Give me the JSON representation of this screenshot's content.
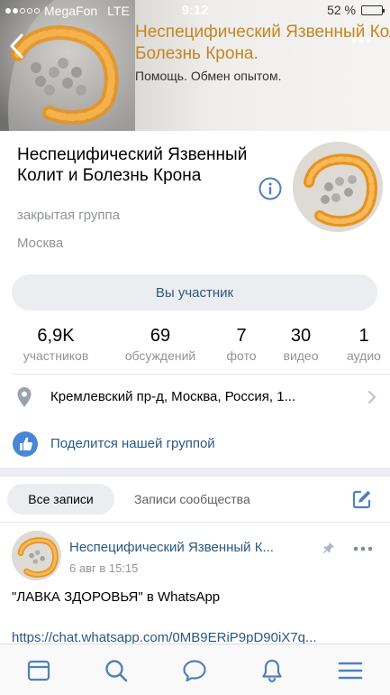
{
  "status_bar": {
    "carrier": "MegaFon",
    "network": "LTE",
    "time": "9:12",
    "battery": "52 %",
    "battery_level": 0.52
  },
  "cover": {
    "title_line1": "Неспецифический Язвенный Колит и",
    "title_line2": "Болезнь Крона.",
    "subtitle": "Помощь. Обмен опытом."
  },
  "group": {
    "title": "Неспецифический Язвенный Колит и Болезнь Крона",
    "type": "закрытая группа",
    "city": "Москва",
    "member_button": "Вы участник"
  },
  "counters": [
    {
      "value": "6,9K",
      "label": "участников"
    },
    {
      "value": "69",
      "label": "обсуждений"
    },
    {
      "value": "7",
      "label": "фото"
    },
    {
      "value": "30",
      "label": "видео"
    },
    {
      "value": "1",
      "label": "аудио"
    }
  ],
  "address": "Кремлевский пр-д, Москва, Россия, 1...",
  "share_label": "Поделится нашей группой",
  "tabs": {
    "all": "Все записи",
    "community": "Записи сообщества"
  },
  "post": {
    "author": "Неспецифический Язвенный К...",
    "date": "6 авг в 15:15",
    "text": "\"ЛАВКА ЗДОРОВЬЯ\" в WhatsApp",
    "link": "https://chat.whatsapp.com/0MB9ERiP9pD90iX7q..."
  },
  "colors": {
    "accent": "#2a5885",
    "secondary_text": "#909499",
    "cover_title": "#c6861f",
    "share_icon": "#4a86d6",
    "nav_icon": "#5181b8"
  },
  "nav_icons": [
    "news-icon",
    "search-icon",
    "messages-icon",
    "notifications-icon",
    "menu-icon"
  ]
}
